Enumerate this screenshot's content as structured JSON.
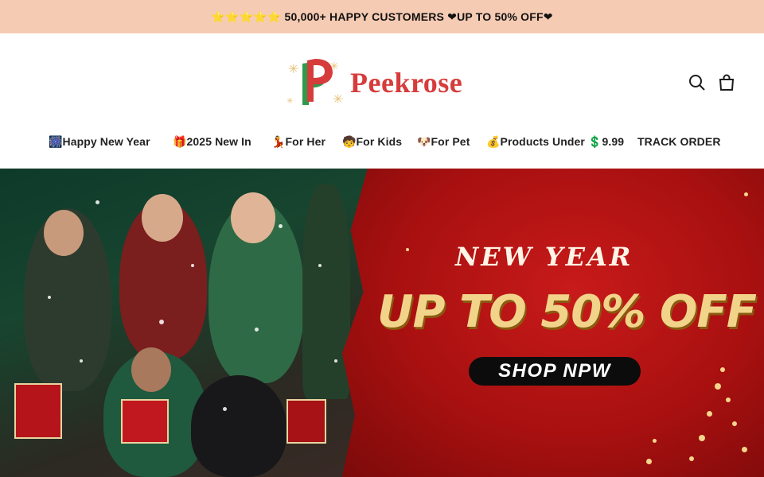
{
  "announcement": {
    "text": "⭐⭐⭐⭐⭐ 50,000+ HAPPY CUSTOMERS ❤UP TO 50% OFF❤"
  },
  "header": {
    "brand_name": "Peekrose",
    "icons": [
      "search-icon",
      "shopping-bag-icon"
    ]
  },
  "nav": {
    "items": [
      {
        "label": "🎆Happy New Year"
      },
      {
        "label": "🎁2025 New In"
      },
      {
        "label": "💃For Her"
      },
      {
        "label": "🧒For Kids"
      },
      {
        "label": "🐶For Pet"
      },
      {
        "label": "💰Products Under 💲9.99"
      },
      {
        "label": "TRACK ORDER"
      }
    ]
  },
  "hero": {
    "headline_small": "NEW YEAR",
    "headline_large": "UP TO 50% OFF",
    "cta_label": "SHOP NPW"
  },
  "colors": {
    "announcement_bg": "#f6cbb3",
    "brand_red": "#d63c3c",
    "brand_green": "#2e9a4c",
    "hero_red": "#c81a1a",
    "headline_gold": "#f2d38a",
    "cta_bg": "#0c0c0c"
  }
}
